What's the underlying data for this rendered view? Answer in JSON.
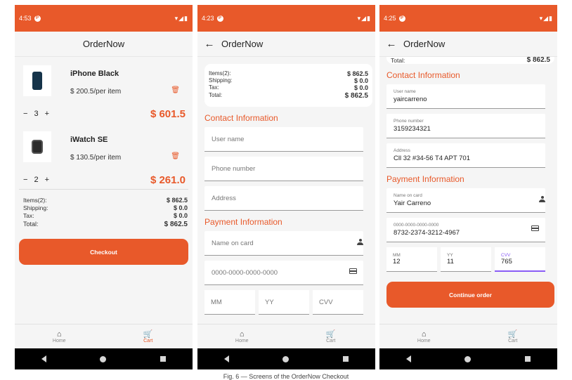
{
  "screens": [
    {
      "status_time": "4:53",
      "app_title": "OrderNow",
      "items": [
        {
          "name": "iPhone Black",
          "price": "$ 200.5/per item",
          "qty": "3",
          "total": "$ 601.5"
        },
        {
          "name": "iWatch SE",
          "price": "$ 130.5/per item",
          "qty": "2",
          "total": "$ 261.0"
        }
      ],
      "summary": {
        "items_label": "Items(2):",
        "items_value": "$ 862.5",
        "shipping_label": "Shipping:",
        "shipping_value": "$ 0.0",
        "tax_label": "Tax:",
        "tax_value": "$ 0.0",
        "total_label": "Total:",
        "total_value": "$ 862.5"
      },
      "cta_label": "Checkout"
    },
    {
      "status_time": "4:23",
      "app_title": "OrderNow",
      "summary": {
        "items_label": "Items(2):",
        "items_value": "$ 862.5",
        "shipping_label": "Shipping:",
        "shipping_value": "$ 0.0",
        "tax_label": "Tax:",
        "tax_value": "$ 0.0",
        "total_label": "Total:",
        "total_value": "$ 862.5"
      },
      "contact_heading": "Contact Information",
      "username_placeholder": "User name",
      "phone_placeholder": "Phone number",
      "address_placeholder": "Address",
      "payment_heading": "Payment Information",
      "cardname_placeholder": "Name on card",
      "cardnumber_placeholder": "0000-0000-0000-0000",
      "mm_placeholder": "MM",
      "yy_placeholder": "YY",
      "cvv_placeholder": "CVV"
    },
    {
      "status_time": "4:25",
      "app_title": "OrderNow",
      "partial_total_label": "Total:",
      "partial_total_value": "$ 862.5",
      "contact_heading": "Contact Information",
      "username_label": "User name",
      "username_value": "yaircarreno",
      "phone_label": "Phone number",
      "phone_value": "3159234321",
      "address_label": "Address",
      "address_value": "Cll 32 #34-56 T4 APT 701",
      "payment_heading": "Payment Information",
      "cardname_label": "Name on card",
      "cardname_value": "Yair Carreno",
      "cardnumber_label": "0000-0000-0000-0000",
      "cardnumber_value": "8732-2374-3212-4967",
      "mm_label": "MM",
      "mm_value": "12",
      "yy_label": "YY",
      "yy_value": "11",
      "cvv_label": "CVV",
      "cvv_value": "765",
      "cta_label": "Continue order"
    }
  ],
  "nav": {
    "home_label": "Home",
    "cart_label": "Cart"
  },
  "colors": {
    "accent": "#e8592a",
    "focus": "#8a5cf6"
  },
  "caption": "Fig. 6 — Screens of the OrderNow Checkout"
}
